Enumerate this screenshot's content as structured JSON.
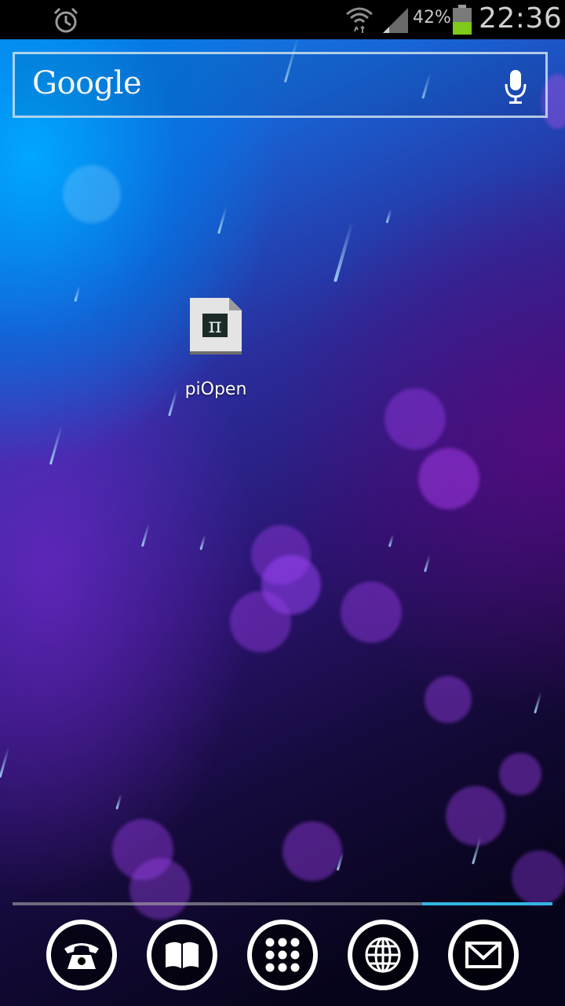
{
  "status_bar": {
    "icons": [
      "alarm-icon",
      "wifi-icon",
      "signal-icon",
      "battery-icon"
    ],
    "battery_percent": "42%",
    "time": "22:36"
  },
  "search": {
    "logo_text": "Google",
    "mic_icon": "microphone-icon"
  },
  "desktop": {
    "apps": [
      {
        "label": "piOpen",
        "icon": "pi-document-icon"
      }
    ]
  },
  "dock": {
    "page_indicator": {
      "pages_total": 1,
      "active": 1
    },
    "items": [
      {
        "name": "phone",
        "icon": "phone-icon"
      },
      {
        "name": "contacts",
        "icon": "book-icon"
      },
      {
        "name": "app-drawer",
        "icon": "apps-grid-icon"
      },
      {
        "name": "browser",
        "icon": "globe-icon"
      },
      {
        "name": "messaging",
        "icon": "envelope-icon"
      }
    ]
  },
  "colors": {
    "accent": "#33b5e5",
    "status_bar_bg": "#000000",
    "battery_fill": "#7ec91a"
  }
}
